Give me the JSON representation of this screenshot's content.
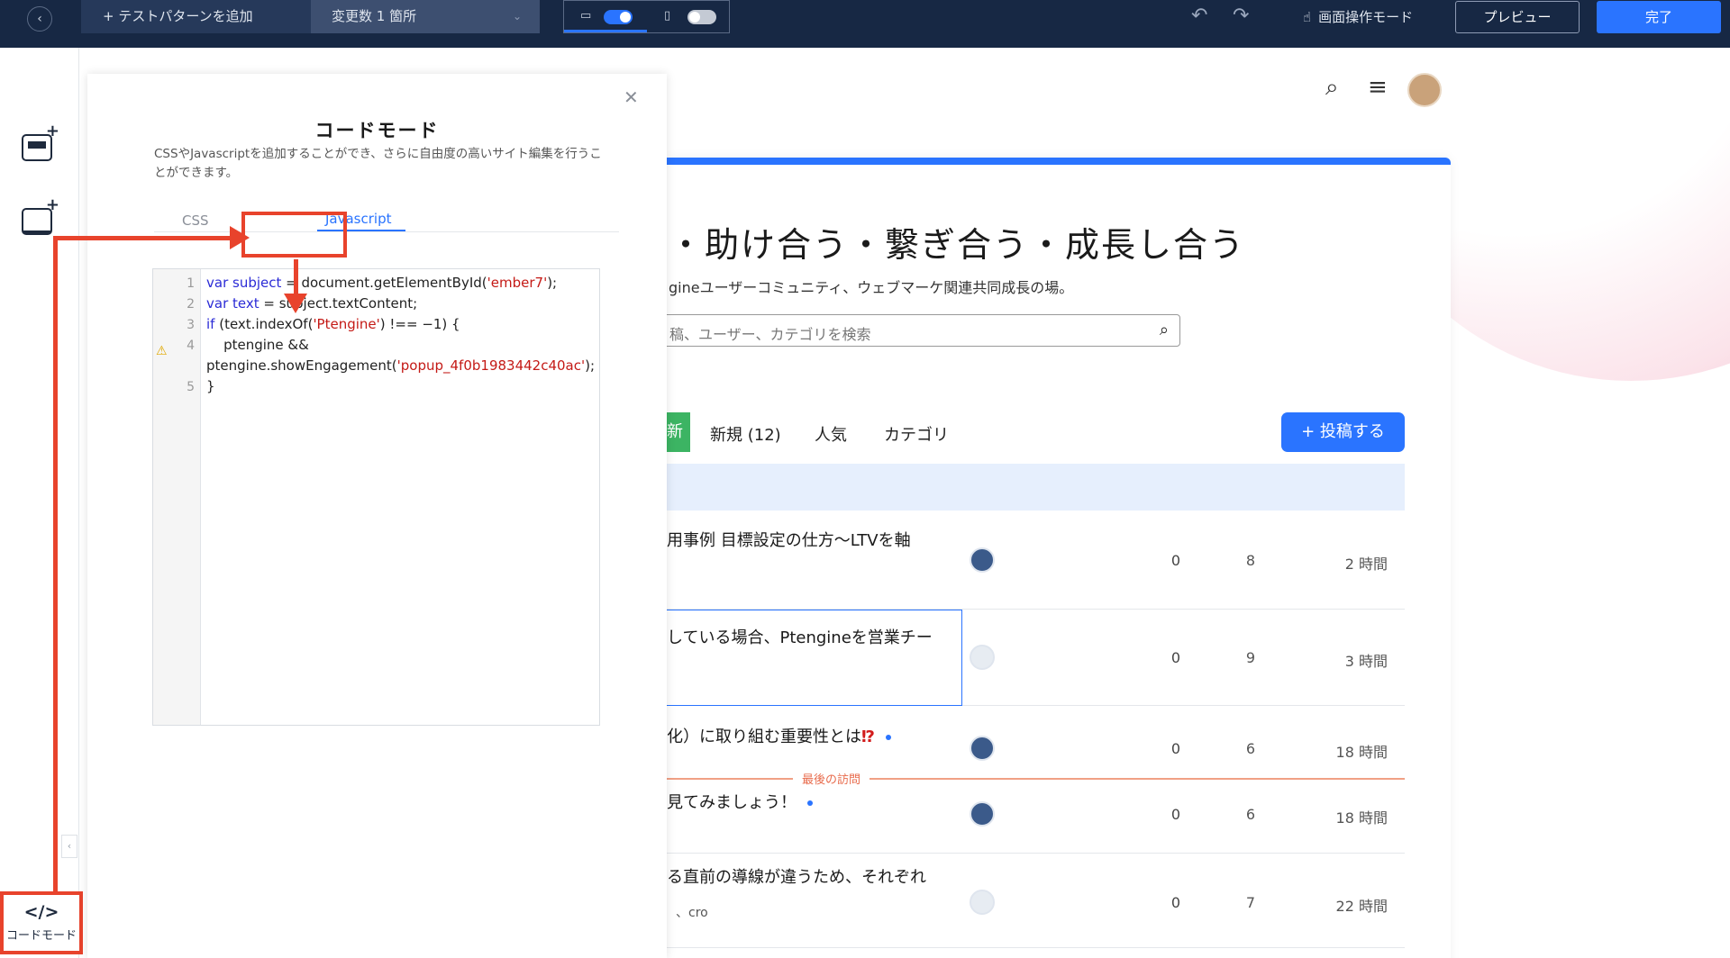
{
  "topbar": {
    "back_icon": "chevron-left-icon",
    "add_pattern": "+ テストパターンを追加",
    "changes": "変更数 1 箇所",
    "device_desktop_icon": "desktop-icon",
    "device_mobile_icon": "mobile-icon",
    "undo_icon": "undo-icon",
    "redo_icon": "redo-icon",
    "mode_label": "画面操作モード",
    "preview": "プレビュー",
    "done": "完了",
    "accent": "#2a74ff"
  },
  "sidebar": {
    "code_mode_label": "コードモード",
    "code_mode_icon": "</>"
  },
  "panel": {
    "title": "コードモード",
    "description": "CSSやJavascriptを追加することができ、さらに自由度の高いサイト編集を行うことができます。",
    "tab_css": "CSS",
    "tab_js": "Javascript",
    "line_numbers": [
      "1",
      "2",
      "3",
      "4",
      "5"
    ],
    "code": {
      "l1_kw": "var subject",
      "l1_rest": " = document.getElementById(",
      "l1_str": "'ember7'",
      "l1_end": ");",
      "l2_kw": "var text",
      "l2_rest": " = subject.textContent;",
      "l3_kw": "if",
      "l3_rest": " (text.indexOf(",
      "l3_str": "'Ptengine'",
      "l3_end": ") !== −1) {",
      "l4a": "    ptengine &&",
      "l4b_rest": "ptengine.showEngagement(",
      "l4b_str": "'popup_4f0b1983442c40ac'",
      "l4b_end": ");",
      "l5": "}"
    }
  },
  "page": {
    "hero_title": "・助け合う・繋ぎ合う・成長し合う",
    "hero_sub": "gineユーザーコミュニティ、ウェブマーケ関連共同成長の場。",
    "search_placeholder": "稿、ユーザー、カテゴリを検索",
    "nav_latest": "新",
    "nav_new": "新規 (12)",
    "nav_popular": "人気",
    "nav_category": "カテゴリ",
    "post_button": "+ 投稿する",
    "last_visit": "最後の訪問",
    "topics": [
      {
        "title": "用事例 目標設定の仕方〜LTVを軸",
        "replies": "0",
        "views": "8",
        "activity": "2 時間"
      },
      {
        "title": "している場合、Ptengineを営業チー",
        "replies": "0",
        "views": "9",
        "activity": "3 時間"
      },
      {
        "title": "化）に取り組む重要性とは",
        "emoji": "⁉",
        "replies": "0",
        "views": "6",
        "activity": "18 時間"
      },
      {
        "title": "見てみましょう！",
        "replies": "0",
        "views": "6",
        "activity": "18 時間"
      },
      {
        "title": "る直前の導線が違うため、それぞれ",
        "tags": "、cro",
        "replies": "0",
        "views": "7",
        "activity": "22 時間"
      }
    ]
  }
}
